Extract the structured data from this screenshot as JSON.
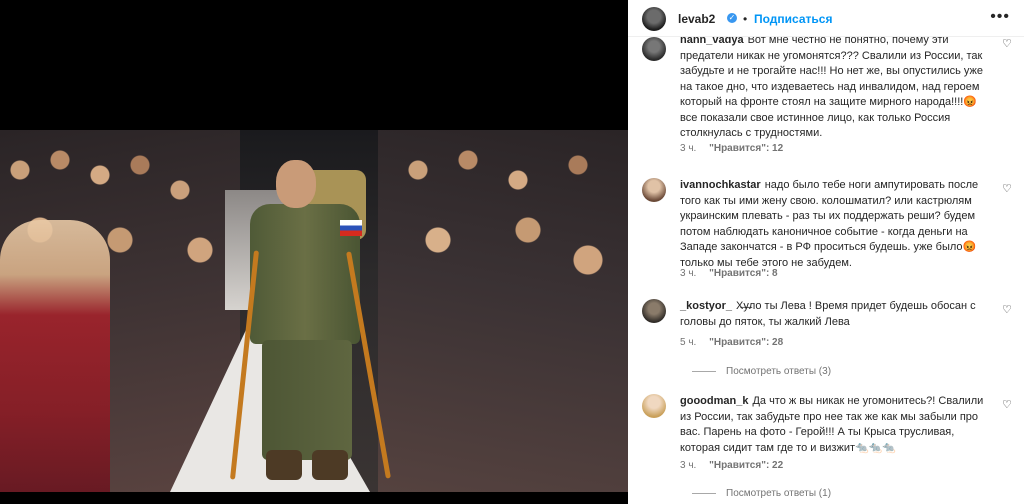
{
  "post": {
    "username": "levab2",
    "verified_icon": "verified-badge-icon",
    "separator": "•",
    "follow_label": "Подписаться",
    "more_icon": "more-options-icon"
  },
  "comments": [
    {
      "username": "nann_vadya",
      "text": "Вот мне честно не понятно, почему эти предатели никак не угомонятся??? Свалили из России, так забудьте и не трогайте нас!!! Но нет же, вы опустились уже на такое дно, что издеваетесь над инвалидом, над героем который на фронте стоял на защите мирного народа!!!!😡 все показали свое истинное лицо, как только Россия столкнулась с трудностями.",
      "time": "3 ч.",
      "likes": "\"Нравится\": 12"
    },
    {
      "username": "ivannochkastar",
      "text": "надо было тебе ноги ампутировать после того как ты ими жену свою. колошматил? или кастрюлям украинским плевать - раз ты их поддержать реши? будем потом наблюдать каноничное событие - когда деньги на Западе закончатся - в РФ проситься будешь. уже было😡 только мы тебе этого не забудем.",
      "time": "3 ч.",
      "likes": "\"Нравится\": 8"
    },
    {
      "username": "_kostyor_",
      "text": "Х̶у̶̶ло ты Лева ! Время придет будешь обосан с головы до пяток, ты жалкий Лева",
      "time": "5 ч.",
      "likes": "\"Нравится\": 28",
      "replies": "Посмотреть ответы (3)"
    },
    {
      "username": "gooodman_k",
      "text": "Да что ж вы никак не угомонитесь?! Свалили из России, так забудьте про нее так же как мы забыли про вас. Парень на фото - Герой!!! А ты Крыса трусливая, которая сидит там где то и визжит🐀🐀🐀",
      "time": "3 ч.",
      "likes": "\"Нравится\": 22",
      "replies": "Посмотреть ответы (1)"
    }
  ],
  "icons": {
    "heart": "♡"
  }
}
